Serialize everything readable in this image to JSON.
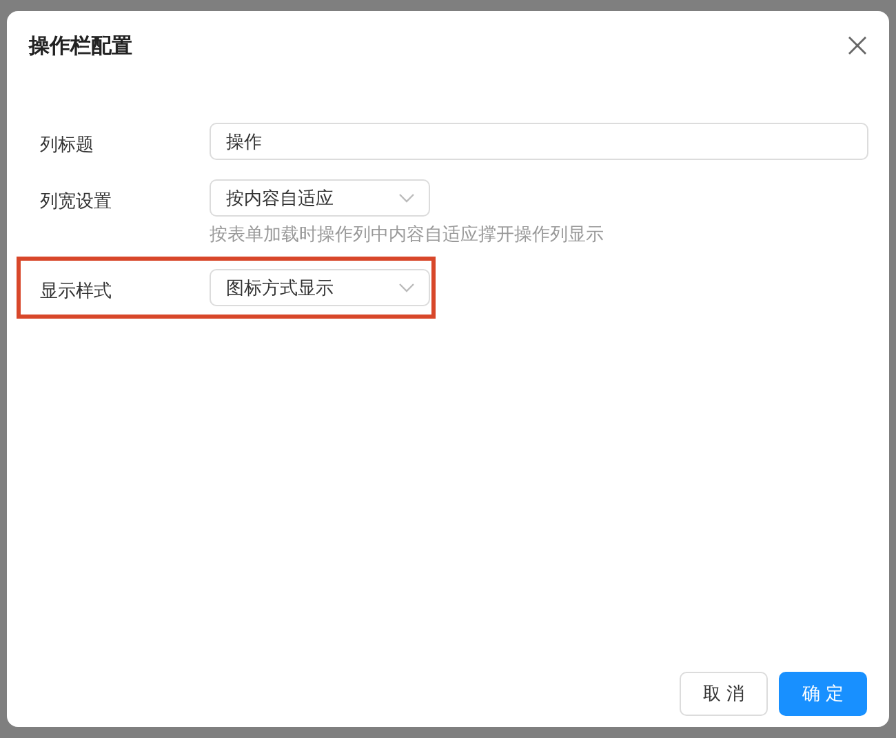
{
  "dialog": {
    "title": "操作栏配置"
  },
  "fields": [
    {
      "label": "列标题",
      "kind": "input",
      "value": "操作",
      "highlighted": false
    },
    {
      "label": "列宽设置",
      "kind": "select",
      "value": "按内容自适应",
      "hint": "按表单加载时操作列中内容自适应撑开操作列显示",
      "highlighted": false
    },
    {
      "label": "显示样式",
      "kind": "select",
      "value": "图标方式显示",
      "highlighted": true
    }
  ],
  "buttons": [
    {
      "label": "取 消",
      "kind": "secondary"
    },
    {
      "label": "确 定",
      "kind": "primary"
    }
  ]
}
